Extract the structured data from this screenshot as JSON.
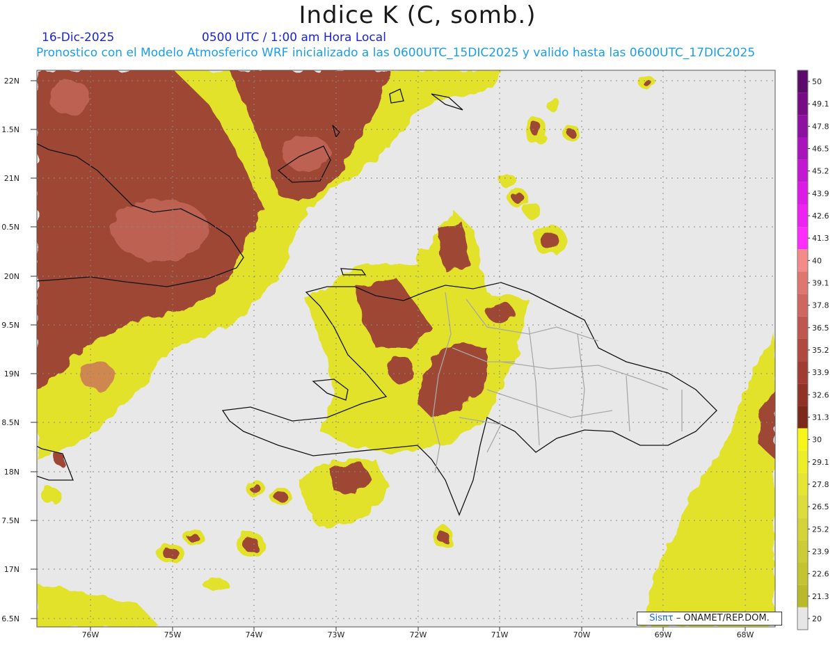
{
  "title": "Indice K (C, somb.)",
  "date_label": "16-Dic-2025",
  "time_label": "0500 UTC / 1:00 am Hora Local",
  "description": "Pronostico con el Modelo Atmosferico WRF inicializado a las 0600UTC_15DIC2025 y valido hasta las  0600UTC_17DIC2025",
  "credit": {
    "brand": "Sisπτ",
    "agency": "– ONAMET/REP.DOM."
  },
  "lat_labels": [
    "22N",
    "1.5N",
    "21N",
    "0.5N",
    "20N",
    "9.5N",
    "19N",
    "8.5N",
    "18N",
    "7.5N",
    "17N",
    "6.5N"
  ],
  "lon_labels": [
    "76W",
    "75W",
    "74W",
    "73W",
    "72W",
    "71W",
    "70W",
    "69W",
    "68W"
  ],
  "colorbar": {
    "labels": [
      "50",
      "49.1",
      "47.8",
      "46.5",
      "45.2",
      "43.9",
      "42.6",
      "41.3",
      "40",
      "39.1",
      "37.8",
      "36.5",
      "35.2",
      "33.9",
      "32.6",
      "31.3",
      "30",
      "29.1",
      "27.8",
      "26.5",
      "25.2",
      "23.9",
      "22.6",
      "21.3",
      "20"
    ],
    "colors": [
      "#5c0a6b",
      "#760b85",
      "#8d10a0",
      "#a814bb",
      "#c318d1",
      "#dc1ce6",
      "#ee22f2",
      "#fe2cfc",
      "#f48a8a",
      "#e07670",
      "#d06660",
      "#c05650",
      "#b04840",
      "#a03c32",
      "#903226",
      "#7c281a",
      "#f6f61a",
      "#eded2a",
      "#e5e534",
      "#dcdc3a",
      "#d4d43a",
      "#cccc36",
      "#c4c430",
      "#baba28",
      "#e6e6e6"
    ]
  },
  "colors": {
    "ocean": "#e8e8e8",
    "yellow": "#e4e428",
    "brown": "#a04a3a",
    "land_boundary": "#111111",
    "province": "#a0a0a0"
  }
}
